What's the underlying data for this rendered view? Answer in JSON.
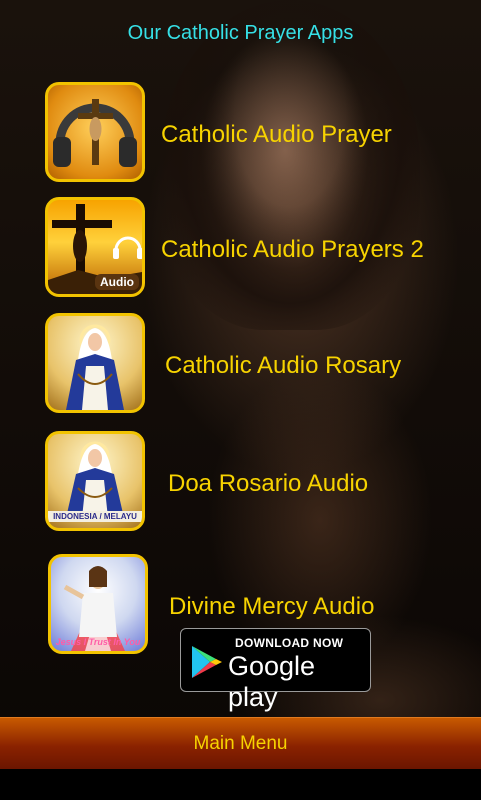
{
  "header": {
    "title": "Our Catholic Prayer Apps"
  },
  "apps": [
    {
      "label": "Catholic Audio Prayer",
      "icon": "audio-crucifix-headphones-icon"
    },
    {
      "label": "Catholic Audio Prayers 2",
      "icon": "crucifix-sunset-icon",
      "badge": "Audio"
    },
    {
      "label": "Catholic Audio Rosary",
      "icon": "virgin-mary-rosary-icon"
    },
    {
      "label": "Doa Rosario Audio",
      "icon": "virgin-mary-rosary-icon",
      "band": "INDONESIA / MELAYU"
    },
    {
      "label": "Divine Mercy Audio",
      "icon": "divine-mercy-icon",
      "caption": "Jesus I Trust In You"
    }
  ],
  "google_play": {
    "download_text": "DOWNLOAD NOW",
    "brand_text": "Google play"
  },
  "footer": {
    "main_menu_label": "Main Menu"
  },
  "colors": {
    "header": "#36e0e6",
    "label": "#f7d300",
    "icon_border": "#f2c300",
    "bar": "#8a2200"
  }
}
